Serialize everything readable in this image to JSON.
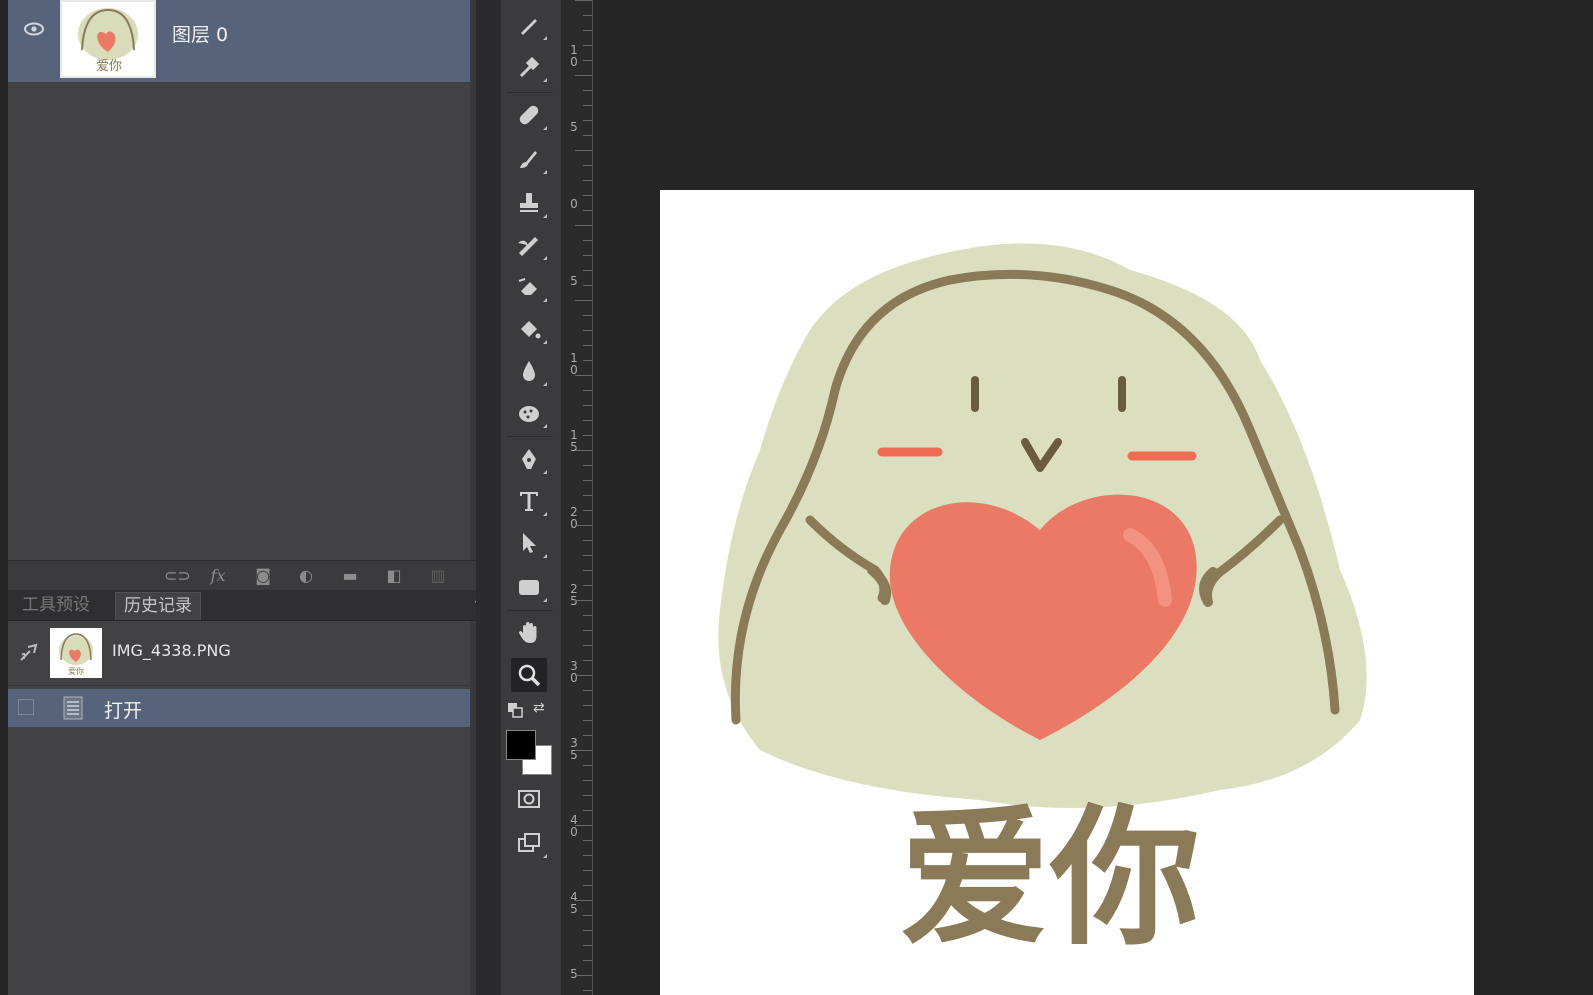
{
  "layers_panel": {
    "layer_name": "图层 0"
  },
  "history_panel": {
    "tabs": [
      {
        "label": "工具预设",
        "active": false
      },
      {
        "label": "历史记录",
        "active": true
      }
    ],
    "snapshot_name": "IMG_4338.PNG",
    "states": [
      {
        "label": "打开",
        "selected": true
      }
    ]
  },
  "toolbar": {
    "tools": [
      "pen-cursor-icon",
      "eyedropper-icon",
      "bandage-icon",
      "brush-icon",
      "stamp-icon",
      "history-brush-icon",
      "eraser-icon",
      "bucket-icon",
      "blur-drop-icon",
      "sponge-icon",
      "pen-icon",
      "type-icon",
      "path-select-icon",
      "rectangle-icon",
      "hand-icon",
      "zoom-icon",
      "screen-mode-icon",
      "arrange-icon"
    ],
    "foreground_color": "#000000",
    "background_color": "#ffffff"
  },
  "ruler": {
    "labels": [
      "1\n0",
      "5",
      "0",
      "5",
      "1\n0",
      "1\n5",
      "2\n0",
      "2\n5",
      "3\n0",
      "3\n5",
      "4\n0",
      "4\n5",
      "5"
    ]
  },
  "canvas": {
    "artwork_text": "爱你",
    "colors": {
      "body": "#d9dcba",
      "outline": "#8a7a58",
      "heart": "#ea7965",
      "blush": "#ef6c54"
    }
  }
}
